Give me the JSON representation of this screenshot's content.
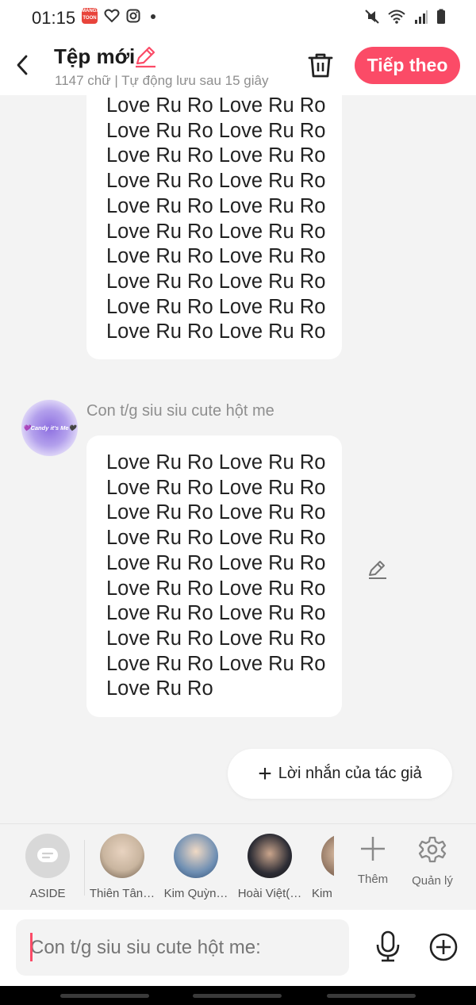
{
  "status_bar": {
    "time": "01:15",
    "app_icon_label": "MANGA TOON",
    "icons": [
      "mangatoon-app-icon",
      "heart-app-icon",
      "instagram-icon",
      "dot-icon",
      "mute-icon",
      "wifi-icon",
      "signal-icon",
      "battery-icon"
    ]
  },
  "header": {
    "title": "Tệp mới",
    "subtitle": "1147 chữ | Tự động lưu sau 15 giây",
    "next_label": "Tiếp theo"
  },
  "messages": {
    "top_bubble": {
      "lines": [
        "Love Ru Ro Love Ru Ro",
        "Love Ru Ro Love Ru Ro",
        "Love Ru Ro Love Ru Ro",
        "Love Ru Ro Love Ru Ro",
        "Love Ru Ro Love Ru Ro",
        "Love Ru Ro Love Ru Ro",
        "Love Ru Ro Love Ru Ro",
        "Love Ru Ro Love Ru Ro",
        "Love Ru Ro Love Ru Ro",
        "Love Ru Ro Love Ru Ro"
      ]
    },
    "sender": {
      "name": "Con t/g siu siu cute hột me",
      "avatar_text": "💜Candy it's Me🖤"
    },
    "bottom_bubble": {
      "lines": [
        "Love Ru Ro Love Ru Ro",
        "Love Ru Ro Love Ru Ro",
        "Love Ru Ro Love Ru Ro",
        "Love Ru Ro Love Ru Ro",
        "Love Ru Ro Love Ru Ro",
        "Love Ru Ro Love Ru Ro",
        "Love Ru Ro Love Ru Ro",
        "Love Ru Ro Love Ru Ro",
        "Love Ru Ro Love Ru Ro",
        "Love Ru Ro"
      ]
    }
  },
  "author_note": {
    "label": "Lời nhắn của tác giả"
  },
  "characters": {
    "aside": "ASIDE",
    "items": [
      {
        "name": "Thiên Tân…",
        "color": "#c9b59f"
      },
      {
        "name": "Kim Quỳn…",
        "color": "#6f8fb3"
      },
      {
        "name": "Hoài Việt(…",
        "color": "#2d2d35"
      },
      {
        "name": "Kim",
        "color": "#8a6f5c"
      }
    ],
    "add_label": "Thêm",
    "manage_label": "Quản lý"
  },
  "composer": {
    "placeholder": "Con t/g siu siu cute hột me:"
  },
  "colors": {
    "accent": "#fb4b67",
    "background": "#f3f3f3",
    "bubble": "#ffffff",
    "muted_text": "#8e8e8e"
  }
}
